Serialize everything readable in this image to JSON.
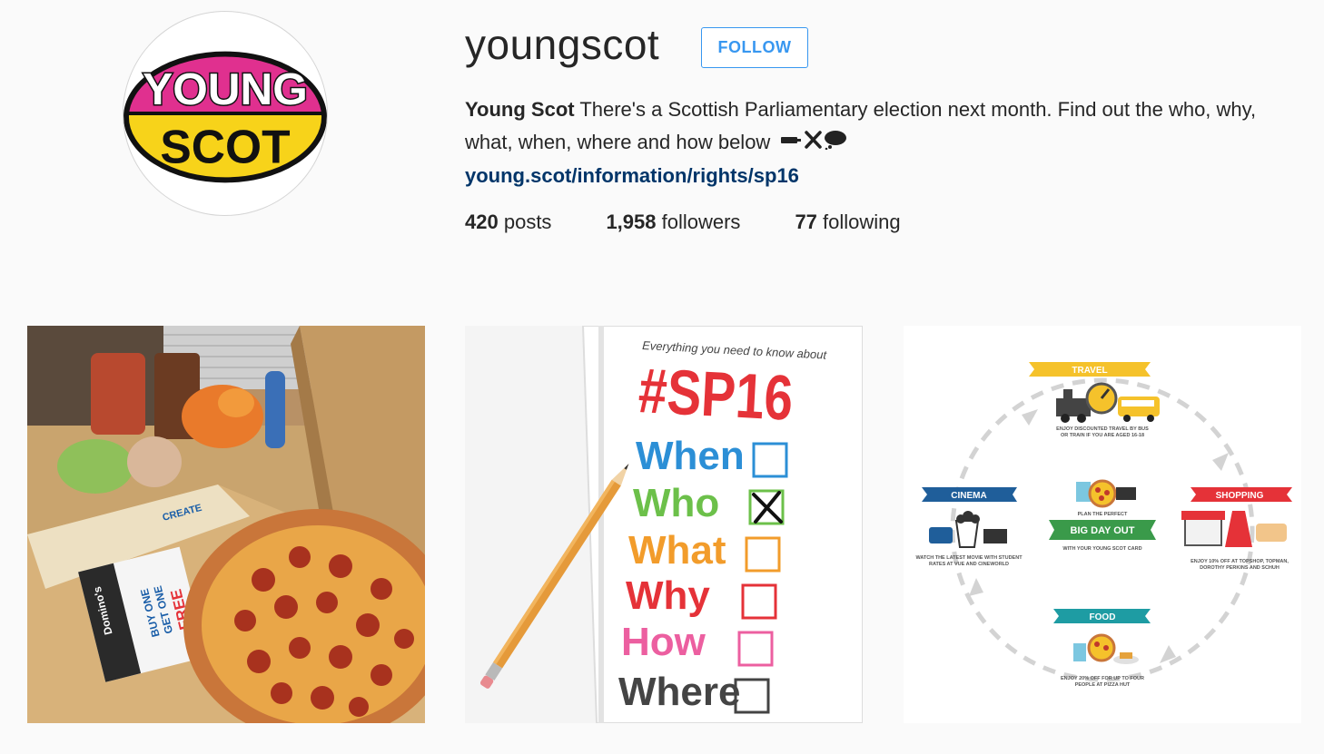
{
  "profile": {
    "username": "youngscot",
    "follow_label": "FOLLOW",
    "avatar_text": {
      "line1": "YOUNG",
      "line2": "SCOT"
    },
    "bio": {
      "name": "Young Scot",
      "text": "There's a Scottish Parliamentary election next month. Find out the who, why, what, when, where and how below",
      "emoji": [
        "ballot-box-icon",
        "x-mark-icon",
        "speech-bubble-icon"
      ],
      "link": "young.scot/information/rights/sp16"
    },
    "stats": {
      "posts_count": "420",
      "posts_label": "posts",
      "followers_count": "1,958",
      "followers_label": "followers",
      "following_count": "77",
      "following_label": "following"
    }
  },
  "posts": [
    {
      "subject": "pizza-and-groceries-photo",
      "texts": {
        "brand": "Domino's",
        "offer1": "BUY ONE",
        "offer2": "GET ONE",
        "offer3": "FREE",
        "box": "CREATE"
      }
    },
    {
      "subject": "sp16-checklist",
      "texts": {
        "intro": "Everything you need to know about",
        "hashtag": "#SP16",
        "items": [
          "When",
          "Who",
          "What",
          "Why",
          "How",
          "Where"
        ]
      }
    },
    {
      "subject": "young-scot-card-infographic",
      "texts": {
        "travel": "TRAVEL",
        "travel_desc1": "ENJOY DISCOUNTED TRAVEL BY BUS",
        "travel_desc2": "OR TRAIN IF YOU ARE AGED 16-18",
        "cinema": "CINEMA",
        "cinema_desc1": "WATCH THE LATEST MOVIE WITH STUDENT",
        "cinema_desc2": "RATES AT VUE AND CINEWORLD",
        "center_top": "PLAN THE PERFECT",
        "center_banner": "BIG DAY OUT",
        "center_bottom": "WITH YOUR YOUNG SCOT CARD",
        "shopping": "SHOPPING",
        "shopping_desc1": "ENJOY 10% OFF AT TOPSHOP, TOPMAN,",
        "shopping_desc2": "DOROTHY PERKINS AND SCHUH",
        "food": "FOOD",
        "food_desc1": "ENJOY 20% OFF FOR UP TO FOUR",
        "food_desc2": "PEOPLE AT PIZZA HUT"
      }
    }
  ],
  "colors": {
    "follow_blue": "#3897f0",
    "link_navy": "#003569",
    "logo_pink": "#e0308f",
    "logo_yellow": "#f7d31a",
    "sp16_red": "#e53238",
    "teal": "#1e9ca3"
  }
}
